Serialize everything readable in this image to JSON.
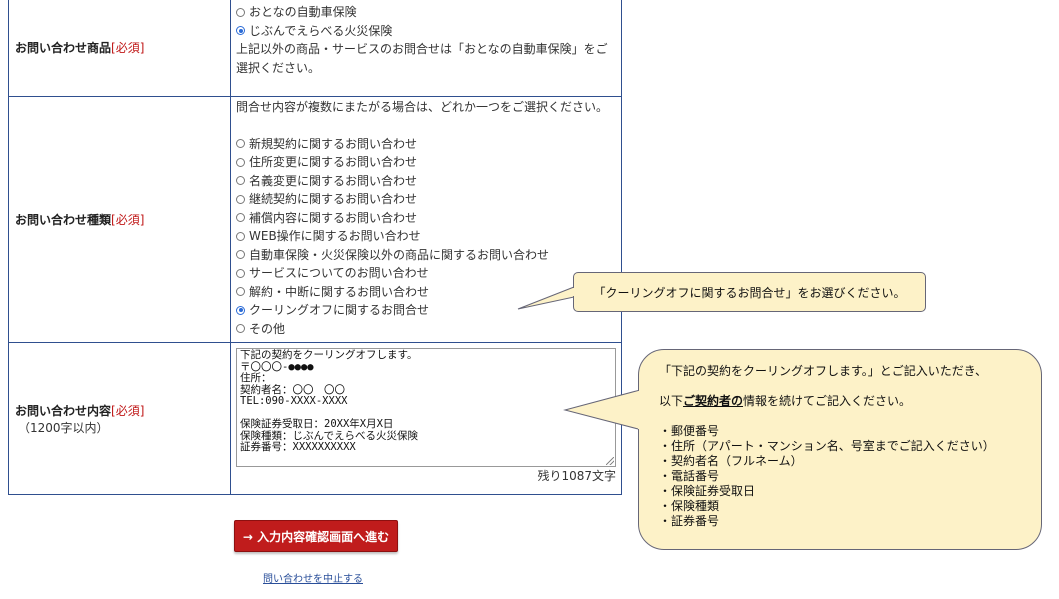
{
  "product": {
    "label": "お問い合わせ商品",
    "required": "[必須]",
    "options": [
      {
        "label": "おとなの自動車保険",
        "checked": false
      },
      {
        "label": "じぶんでえらべる火災保険",
        "checked": true
      }
    ],
    "note_line1": "上記以外の商品・サービスのお問合せは「おとなの自動車保険」をご",
    "note_line2": "選択ください。"
  },
  "type": {
    "label": "お問い合わせ種類",
    "required": "[必須]",
    "intro": "問合せ内容が複数にまたがる場合は、どれか一つをご選択ください。",
    "options": [
      {
        "label": "新規契約に関するお問い合わせ",
        "checked": false
      },
      {
        "label": "住所変更に関するお問い合わせ",
        "checked": false
      },
      {
        "label": "名義変更に関するお問い合わせ",
        "checked": false
      },
      {
        "label": "継続契約に関するお問い合わせ",
        "checked": false
      },
      {
        "label": "補償内容に関するお問い合わせ",
        "checked": false
      },
      {
        "label": "WEB操作に関するお問い合わせ",
        "checked": false
      },
      {
        "label": "自動車保険・火災保険以外の商品に関するお問い合わせ",
        "checked": false
      },
      {
        "label": "サービスについてのお問い合わせ",
        "checked": false
      },
      {
        "label": "解約・中断に関するお問い合わせ",
        "checked": false
      },
      {
        "label": "クーリングオフに関するお問合せ",
        "checked": true
      },
      {
        "label": "その他",
        "checked": false
      }
    ]
  },
  "content": {
    "label": "お問い合わせ内容",
    "required": "[必須]",
    "limit": "（1200字以内）",
    "textarea_value": "下記の契約をクーリングオフします。\n〒〇〇〇-●●●●\n住所：\n契約者名：〇〇　〇〇\nTEL:090-XXXX-XXXX\n\n保険証券受取日：20XX年X月X日\n保険種類：じぶんでえらべる火災保険\n証券番号：XXXXXXXXXX",
    "remaining": "残り1087文字"
  },
  "actions": {
    "submit": "→ 入力内容確認画面へ進む",
    "cancel": "問い合わせを中止する"
  },
  "callout1": {
    "text": "「クーリングオフに関するお問合せ」をお選びください。"
  },
  "callout2": {
    "line1": "「下記の契約をクーリングオフします。」とご記入いただき、",
    "line2_pre": "以下",
    "line2_em": "ご契約者の",
    "line2_post": "情報を続けてご記入ください。",
    "items": [
      "・郵便番号",
      "・住所（アパート・マンション名、号室までご記入ください）",
      "・契約者名（フルネーム）",
      "・電話番号",
      "・保険証券受取日",
      "・保険種類",
      "・証券番号"
    ]
  },
  "colors": {
    "required": "#c01818",
    "submit_bg": "#c01c1c",
    "callout_bg": "#fdf2c8",
    "table_border": "#2f4f8f",
    "link": "#2a4f9a"
  }
}
